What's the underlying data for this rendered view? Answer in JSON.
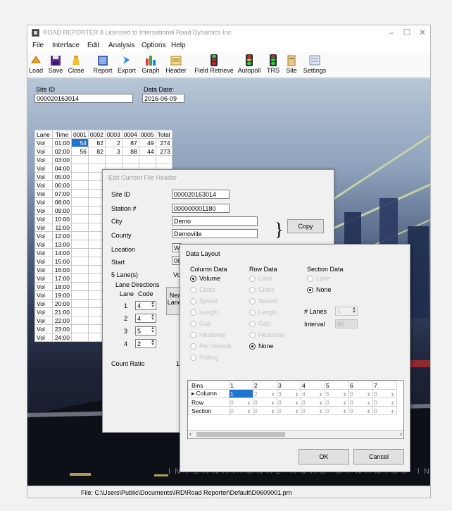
{
  "window": {
    "title": "ROAD REPORTER 8 Licensed to International Road Dynamics Inc.",
    "controls": [
      "–",
      "☐",
      "✕"
    ]
  },
  "menu": [
    "File",
    "Interface",
    "Edit",
    "Analysis",
    "Options",
    "Help"
  ],
  "toolbar": [
    {
      "label": "Load",
      "icon": "load-icon"
    },
    {
      "label": "Save",
      "icon": "save-icon"
    },
    {
      "label": "Close",
      "icon": "close-file-icon"
    },
    {
      "label": "Report",
      "icon": "report-icon"
    },
    {
      "label": "Export",
      "icon": "export-icon"
    },
    {
      "label": "Graph",
      "icon": "graph-icon"
    },
    {
      "label": "Header",
      "icon": "header-icon"
    },
    {
      "label": "Field Retrieve",
      "icon": "traffic-light-icon"
    },
    {
      "label": "Autopoll",
      "icon": "traffic-light-icon"
    },
    {
      "label": "TRS",
      "icon": "traffic-light-icon"
    },
    {
      "label": "Site",
      "icon": "site-icon"
    },
    {
      "label": "Settings",
      "icon": "settings-icon"
    }
  ],
  "site_panel": {
    "site_id_label": "Site ID",
    "site_id": "000020163014",
    "data_date_label": "Data Date:",
    "data_date": "2016-06-09"
  },
  "grid": {
    "headers": [
      "Lane",
      "Time",
      "0001",
      "0002",
      "0003",
      "0004",
      "0005",
      "Total"
    ],
    "rows": [
      [
        "Vol",
        "01:00",
        "54",
        "82",
        "2",
        "87",
        "49",
        "274"
      ],
      [
        "Vol",
        "02:00",
        "56",
        "82",
        "3",
        "88",
        "44",
        "273"
      ],
      [
        "Vol",
        "03:00"
      ],
      [
        "Vol",
        "04:00"
      ],
      [
        "Vol",
        "05:00"
      ],
      [
        "Vol",
        "06:00"
      ],
      [
        "Vol",
        "07:00"
      ],
      [
        "Vol",
        "08:00"
      ],
      [
        "Vol",
        "09:00"
      ],
      [
        "Vol",
        "10:00"
      ],
      [
        "Vol",
        "11:00"
      ],
      [
        "Vol",
        "12:00"
      ],
      [
        "Vol",
        "13:00"
      ],
      [
        "Vol",
        "14:00"
      ],
      [
        "Vol",
        "15:00"
      ],
      [
        "Vol",
        "16:00"
      ],
      [
        "Vol",
        "17:00"
      ],
      [
        "Vol",
        "18:00"
      ],
      [
        "Vol",
        "19:00"
      ],
      [
        "Vol",
        "20:00"
      ],
      [
        "Vol",
        "21:00"
      ],
      [
        "Vol",
        "22:00"
      ],
      [
        "Vol",
        "23:00"
      ],
      [
        "Vol",
        "24:00"
      ]
    ]
  },
  "header_dialog": {
    "title": "Edit Current File Header",
    "site_id_label": "Site ID",
    "site_id": "000020163014",
    "station_label": "Station #",
    "station": "000000001180",
    "city_label": "City",
    "city": "Demo",
    "county_label": "County",
    "county": "Demoville",
    "location_label": "Location",
    "location": "W",
    "start_label": "Start",
    "start": "06",
    "lanes_label": "5 Lane(s)",
    "vo_label": "Vo",
    "lane_directions_label": "Lane Directions",
    "lane_col_label": "Lane",
    "code_col_label": "Code",
    "lanes": [
      {
        "lane": "1",
        "code": "4"
      },
      {
        "lane": "2",
        "code": "4"
      },
      {
        "lane": "3",
        "code": "5"
      },
      {
        "lane": "4",
        "code": "2"
      }
    ],
    "next_label": "Next",
    "lanes_btn_label": "Lanes",
    "count_ratio_label": "Count Ratio",
    "count_ratio_value": "1(",
    "copy_label": "Copy",
    "brace": "}"
  },
  "layout_dialog": {
    "title": "Data Layout",
    "column_data_title": "Column Data",
    "column_options": [
      "Volume",
      "Class",
      "Speed",
      "Length",
      "Gap",
      "Headway",
      "Per Vehicle",
      "Polling"
    ],
    "row_data_title": "Row Data",
    "row_options": [
      "Lane",
      "Class",
      "Speed",
      "Length",
      "Gap",
      "Headway",
      "None"
    ],
    "section_data_title": "Section Data",
    "section_options": [
      "Lane",
      "None"
    ],
    "num_lanes_label": "# Lanes",
    "num_lanes": "5",
    "interval_label": "Interval",
    "interval": "60",
    "bins": {
      "corner": "Bins",
      "columns": [
        "1",
        "2",
        "3",
        "4",
        "5",
        "6",
        "7"
      ],
      "rows": [
        {
          "label": "Column",
          "values": [
            "1",
            "2",
            "3",
            "4",
            "5",
            "0",
            "0"
          ]
        },
        {
          "label": "Row",
          "values": [
            "0",
            "0",
            "0",
            "0",
            "0",
            "0",
            "0"
          ]
        },
        {
          "label": "Section",
          "values": [
            "0",
            "0",
            "0",
            "0",
            "0",
            "0",
            "0"
          ]
        }
      ]
    },
    "ok_label": "OK",
    "cancel_label": "Cancel"
  },
  "watermark": "INTERNATIONAL ROAD DYNAMICS INC",
  "status": "File: C:\\Users\\Public\\Documents\\IRD\\Road Reporter\\Default\\D0609001.prn"
}
